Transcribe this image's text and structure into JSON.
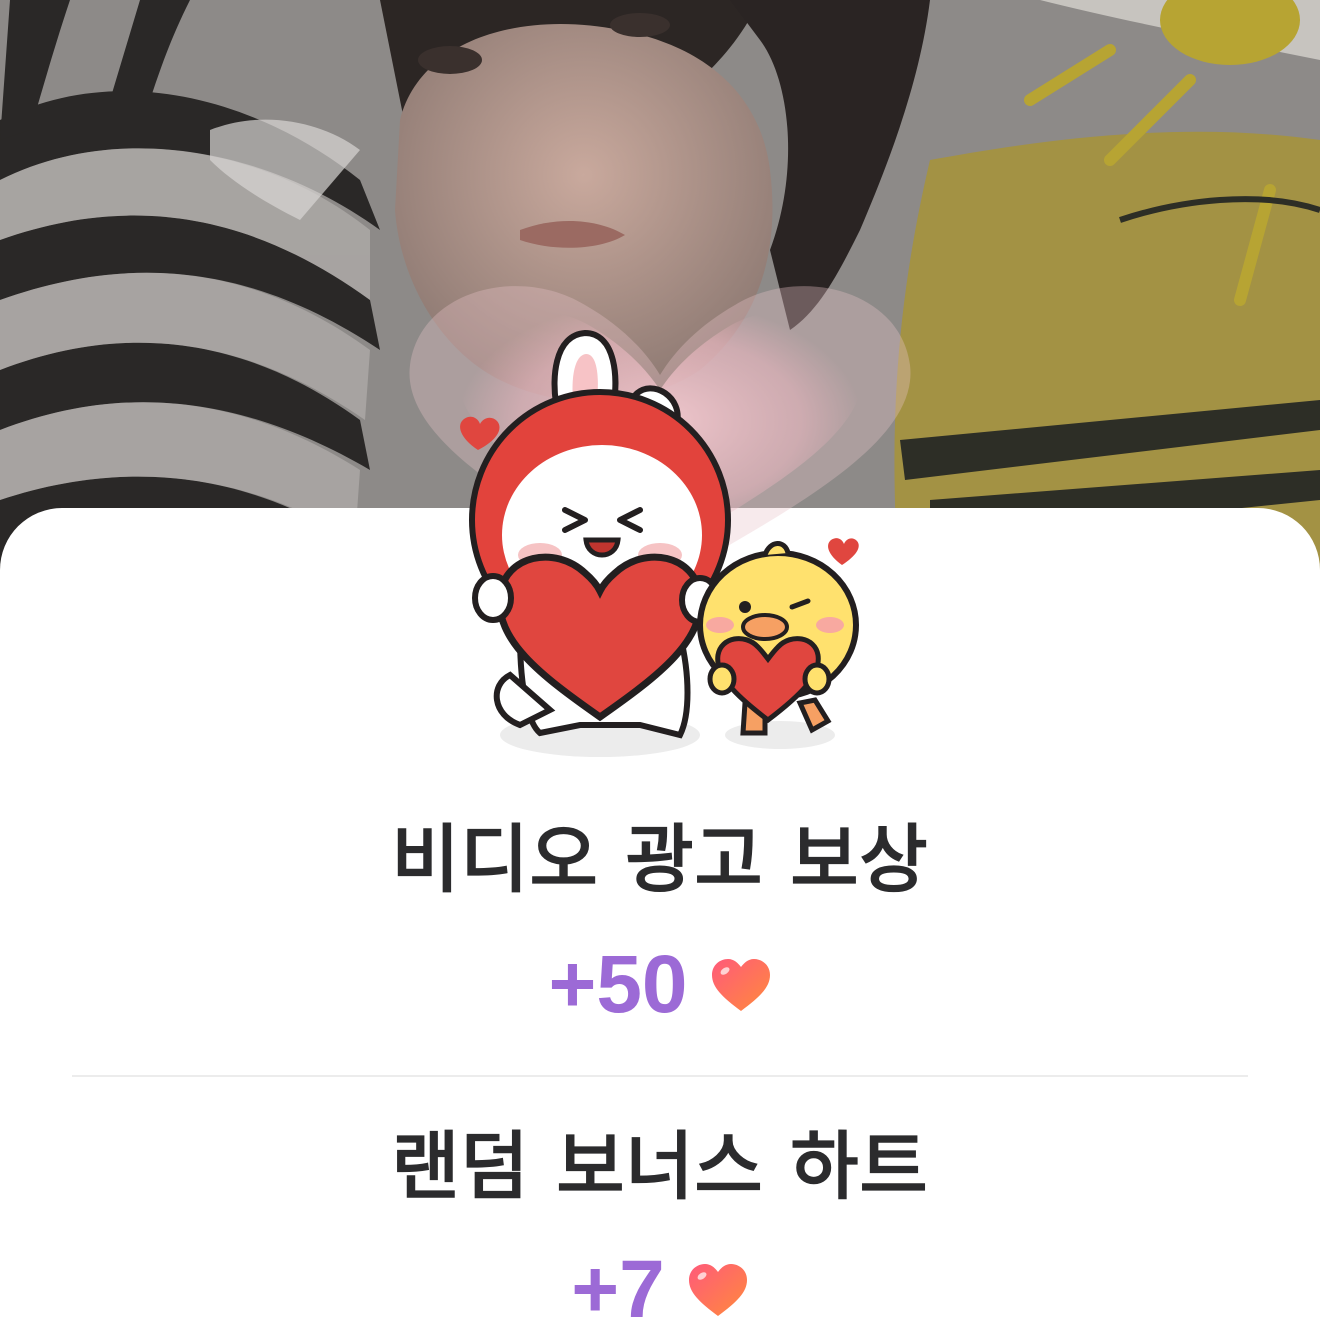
{
  "rewards": [
    {
      "title": "비디오 광고 보상",
      "amount": "+50",
      "icon": "heart-icon"
    },
    {
      "title": "랜덤 보너스 하트",
      "amount": "+7",
      "icon": "heart-icon"
    }
  ],
  "colors": {
    "title_text": "#2b2b2d",
    "amount_text": "#9c6ad6",
    "sheet_background": "#ffffff",
    "divider": "#ececec"
  }
}
